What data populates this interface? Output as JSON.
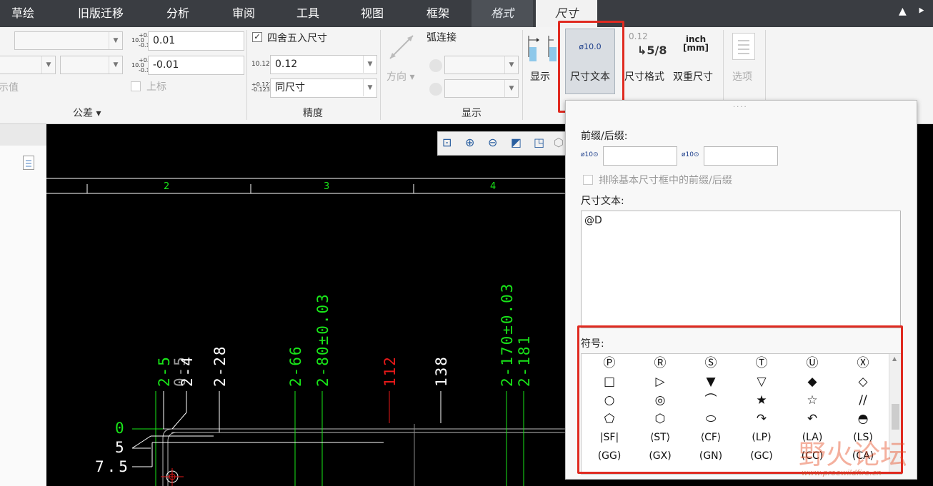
{
  "menu": {
    "tabs": [
      "草绘",
      "旧版迁移",
      "分析",
      "审阅",
      "工具",
      "视图",
      "框架",
      "格式",
      "尺寸"
    ],
    "collapse_icon": "chevron-up-icon",
    "pin_icon": "pin-icon"
  },
  "ribbon": {
    "tolerance": {
      "label": "公差",
      "upper_value": "0.01",
      "lower_value": "-0.01",
      "partial_label": "示值",
      "upper_label": "上标",
      "icon_upper": [
        "+0.2",
        "10.0",
        "-0.1"
      ],
      "icon_lower": [
        "+0.2",
        "10.0",
        "-0.1"
      ]
    },
    "precision": {
      "label": "精度",
      "round_label": "四舍五入尺寸",
      "round_checked": true,
      "value": "0.12",
      "value_icon": "10.123",
      "tol_value": "同尺寸",
      "tol_icon": [
        "+0.123",
        "-0.123"
      ]
    },
    "display": {
      "label": "显示",
      "direction_label": "方向",
      "arc_label": "弧连接"
    },
    "buttons": {
      "show": "显示",
      "dim_text": "尺寸文本",
      "dim_text_icon": "ø10.0",
      "dim_format": "尺寸格式",
      "dim_format_icon_a": "0.12",
      "dim_format_icon_b": "5/8",
      "dual_dim": "双重尺寸",
      "dual_icon_a": "inch",
      "dual_icon_b": "[mm]",
      "options": "选项"
    }
  },
  "canvas": {
    "ruler": [
      "2",
      "3",
      "4"
    ],
    "dims_vertical": [
      "2-5",
      "0-5",
      "2-4",
      "2-28",
      "2-66",
      "2-80±0.03",
      "112",
      "138",
      "2-170±0.03",
      "2-181"
    ],
    "dims_horizontal": [
      "0",
      "5",
      "7.5"
    ]
  },
  "popup": {
    "prefix_label": "前缀/后缀:",
    "prefix_icon": "ø10⊙",
    "suffix_icon": "ø10⊙",
    "exclude_label": "排除基本尺寸框中的前缀/后缀",
    "text_label": "尺寸文本:",
    "text_value": "@D",
    "symbols_label": "符号:",
    "symbols": [
      [
        "Ⓟ",
        "Ⓡ",
        "Ⓢ",
        "Ⓣ",
        "Ⓤ",
        "Ⓧ"
      ],
      [
        "□",
        "▷",
        "▼",
        "▽",
        "◆",
        "◇"
      ],
      [
        "○",
        "◎",
        "⌒",
        "★",
        "☆",
        "//"
      ],
      [
        "⬠",
        "⬡",
        "⬭",
        "↷",
        "↶",
        "◓"
      ],
      [
        "|SF|",
        "⟨ST⟩",
        "⟨CF⟩",
        "(LP)",
        "(LA)",
        "(LS)"
      ],
      [
        "(GG)",
        "(GX)",
        "(GN)",
        "(GC)",
        "(CC)",
        "(CA)"
      ]
    ]
  },
  "watermark": {
    "text": "野火论坛",
    "url": "www.proewildfire.cn"
  },
  "colors": {
    "menubar": "#3a3d42",
    "canvas_bg": "#000000",
    "dim_green": "#19e619",
    "dim_red": "#e61919",
    "highlight": "#e02a20"
  }
}
